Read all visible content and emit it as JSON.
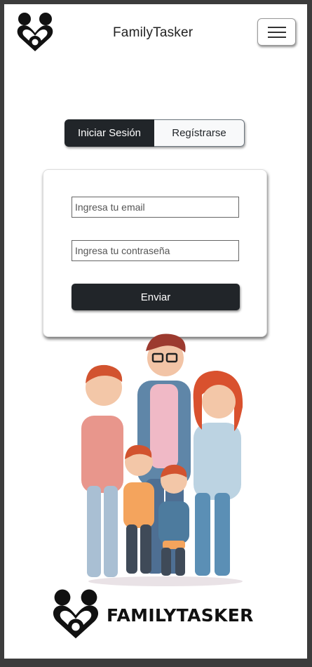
{
  "header": {
    "title": "FamilyTasker",
    "logo_icon": "family-heart-logo-icon",
    "menu_icon": "hamburger-menu-icon"
  },
  "tabs": [
    {
      "label": "Iniciar Sesión",
      "active": true
    },
    {
      "label": "Regístrarse",
      "active": false
    }
  ],
  "login_form": {
    "email_placeholder": "Ingresa tu email",
    "email_value": "",
    "password_placeholder": "Ingresa tu contraseña",
    "password_value": "",
    "submit_label": "Enviar"
  },
  "illustration": {
    "subject": "family-illustration"
  },
  "footer_brand": {
    "name": "FAMILYTASKER",
    "logo_icon": "family-heart-logo-icon"
  },
  "colors": {
    "dark": "#212529",
    "light": "#f8f9fa",
    "frame": "#3c3c3c"
  }
}
